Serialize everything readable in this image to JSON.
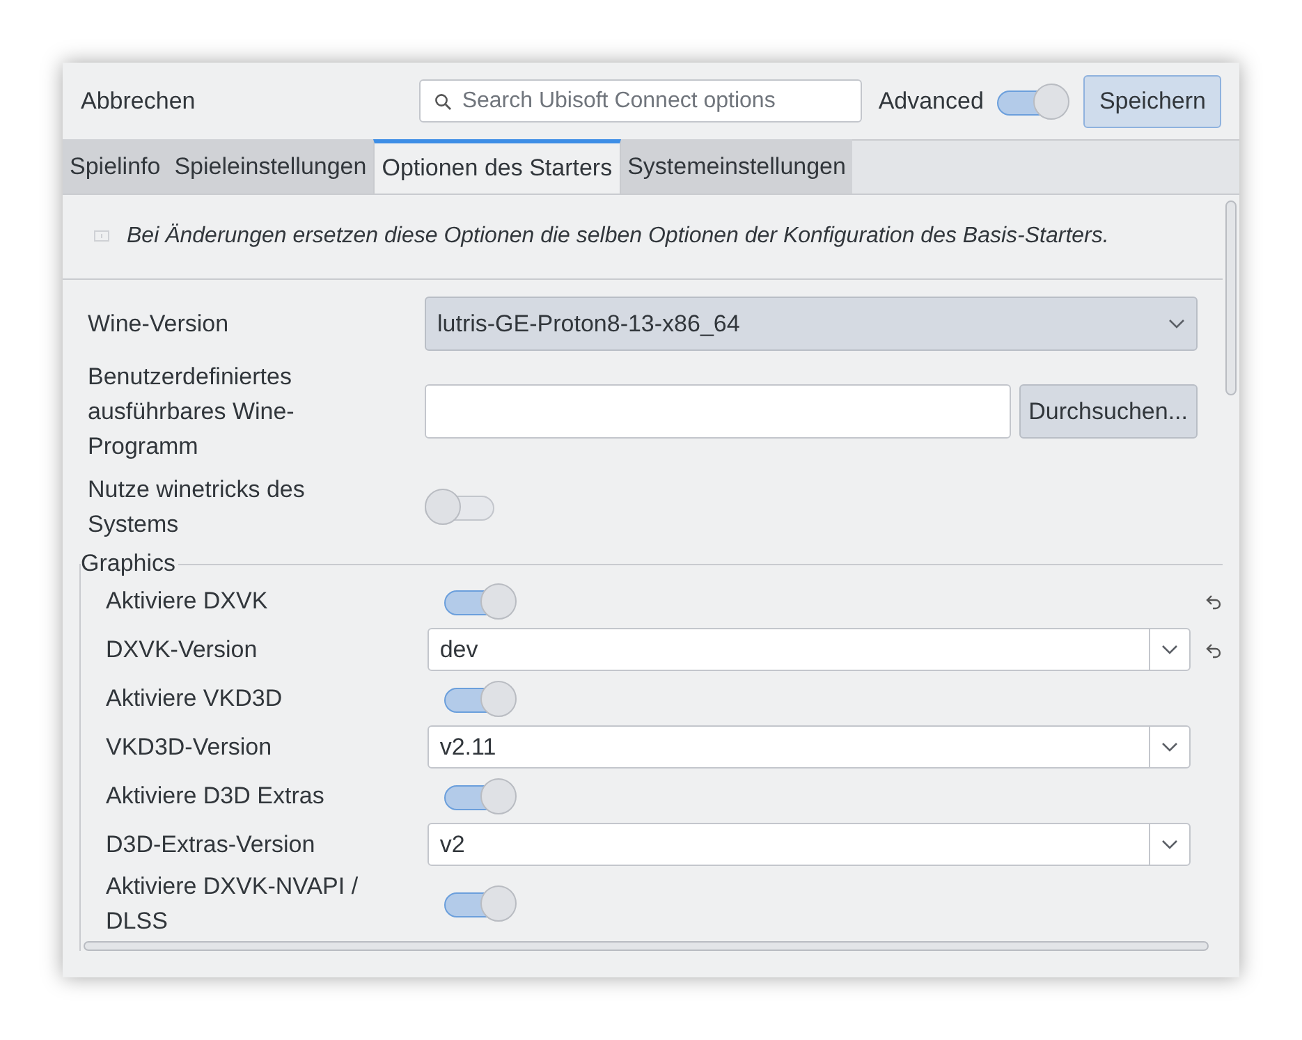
{
  "header": {
    "cancel": "Abbrechen",
    "search": {
      "placeholder": "Search Ubisoft Connect options"
    },
    "advanced": {
      "label": "Advanced",
      "on": true
    },
    "save": "Speichern"
  },
  "tabs": [
    {
      "label": "Spielinfo",
      "selected": false
    },
    {
      "label": "Spieleinstellungen",
      "selected": false
    },
    {
      "label": "Optionen des Starters",
      "selected": true
    },
    {
      "label": "Systemeinstellungen",
      "selected": false
    }
  ],
  "notice": "Bei Änderungen ersetzen diese Optionen die selben Optionen der Konfiguration des Basis-Starters.",
  "general": [
    {
      "kind": "select",
      "label": "Wine-Version",
      "value": "lutris-GE-Proton8-13-x86_64"
    },
    {
      "kind": "file",
      "label": "Benutzerdefiniertes ausführbares Wine-Programm",
      "button": "Durchsuchen..."
    },
    {
      "kind": "toggle",
      "label": "Nutze winetricks des Systems",
      "on": false
    }
  ],
  "graphics": {
    "title": "Graphics",
    "rows": [
      {
        "kind": "toggle",
        "label": "Aktiviere DXVK",
        "on": true,
        "reset": true
      },
      {
        "kind": "select",
        "label": "DXVK-Version",
        "value": "dev",
        "reset": true
      },
      {
        "kind": "toggle",
        "label": "Aktiviere VKD3D",
        "on": true,
        "reset": false
      },
      {
        "kind": "select",
        "label": "VKD3D-Version",
        "value": "v2.11",
        "reset": false
      },
      {
        "kind": "toggle",
        "label": "Aktiviere D3D Extras",
        "on": true,
        "reset": false
      },
      {
        "kind": "select",
        "label": "D3D-Extras-Version",
        "value": "v2",
        "reset": false
      },
      {
        "kind": "toggle",
        "label": "Aktiviere DXVK-NVAPI / DLSS",
        "on": true,
        "reset": false
      }
    ]
  }
}
